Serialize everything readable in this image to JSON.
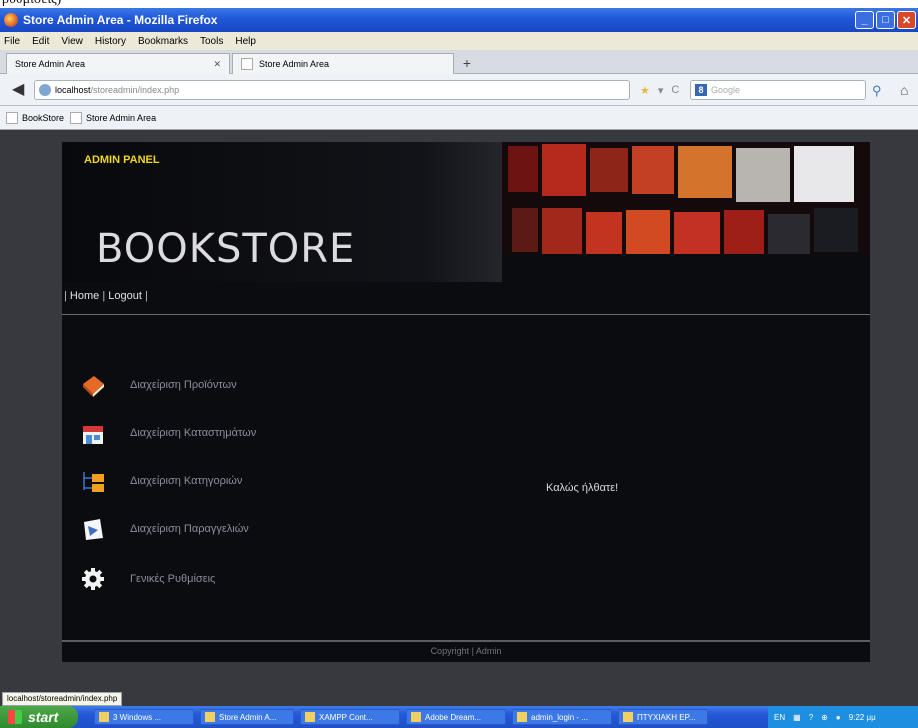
{
  "document_fragment": "ρυθμίσεις)",
  "window": {
    "title": "Store Admin Area - Mozilla Firefox"
  },
  "menu": [
    "File",
    "Edit",
    "View",
    "History",
    "Bookmarks",
    "Tools",
    "Help"
  ],
  "tabs": [
    {
      "label": "Store Admin Area"
    },
    {
      "label": "Store Admin Area"
    }
  ],
  "address": {
    "host": "localhost",
    "path": "/storeadmin/index.php"
  },
  "search": {
    "placeholder": "Google"
  },
  "bookmarks": [
    "BookStore",
    "Store Admin Area"
  ],
  "page": {
    "admin_panel": "ADMIN PANEL",
    "brand": "BOOKSTORE",
    "nav": {
      "home": "Home",
      "logout": "Logout"
    },
    "menu_items": [
      {
        "label": "Διαχείριση Προϊόντων",
        "icon": "book-icon"
      },
      {
        "label": "Διαχείριση Καταστημάτων",
        "icon": "store-icon"
      },
      {
        "label": "Διαχείριση Κατηγοριών",
        "icon": "folder-tree-icon"
      },
      {
        "label": "Διαχείριση Παραγγελιών",
        "icon": "orders-icon"
      },
      {
        "label": "Γενικές Ρυθμίσεις",
        "icon": "gear-icon"
      }
    ],
    "welcome": "Καλώς ήλθατε!",
    "footer": "Copyright | Admin"
  },
  "status_url": "localhost/storeadmin/index.php",
  "taskbar": {
    "start": "start",
    "tasks": [
      "3 Windows ...",
      "Store Admin A...",
      "XAMPP Cont...",
      "Adobe Dream...",
      "admin_login - ...",
      "ΠΤΥΧΙΑΚΗ ΕΡ..."
    ],
    "tray": {
      "lang": "EN",
      "time": "9:22 μμ"
    }
  }
}
